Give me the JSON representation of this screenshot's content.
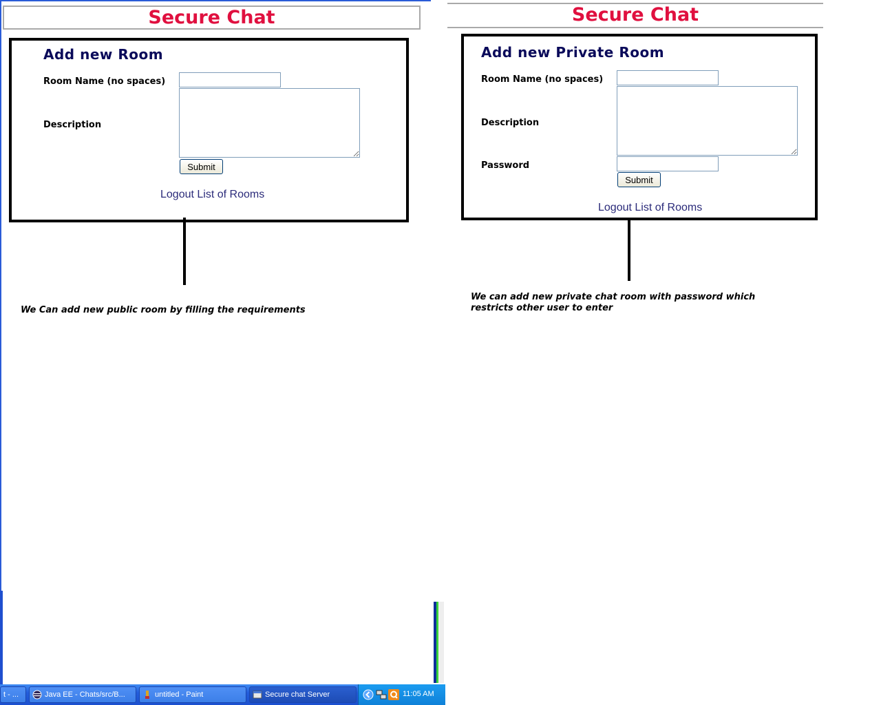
{
  "left": {
    "header": "Secure Chat",
    "title": "Add new Room",
    "room_label": "Room Name (no spaces)",
    "desc_label": "Description",
    "submit": "Submit",
    "logout": "Logout",
    "list_rooms": "List of Rooms",
    "note": "We Can add new public room by filling the requirements"
  },
  "right": {
    "header": "Secure Chat",
    "title": "Add new Private Room",
    "room_label": "Room Name (no spaces)",
    "desc_label": "Description",
    "password_label": "Password",
    "submit": "Submit",
    "logout": "Logout",
    "list_rooms": "List of Rooms",
    "note_line1": "We can add new private chat room with password which",
    "note_line2": "restricts other user to enter"
  },
  "taskbar": {
    "items": [
      {
        "label": "t - ...",
        "icon": "window-icon"
      },
      {
        "label": "Java EE - Chats/src/B...",
        "icon": "eclipse-icon"
      },
      {
        "label": "untitled - Paint",
        "icon": "paint-icon"
      },
      {
        "label": "Secure chat Server",
        "icon": "java-app-icon"
      }
    ],
    "clock": "11:05 AM",
    "tray_icons": [
      "show-hidden-icon",
      "network-icon",
      "quicktime-icon"
    ]
  },
  "colors": {
    "header_text": "#e0103f",
    "title_text": "#0a0a5a",
    "link_text": "#2b2b7a",
    "taskbar": "#245edb"
  }
}
